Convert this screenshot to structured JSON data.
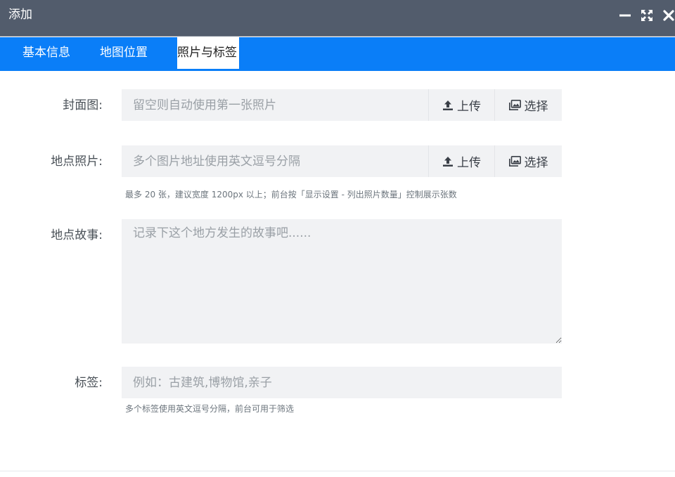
{
  "window": {
    "title": "添加",
    "controls": [
      "minimize-icon",
      "maximize-icon",
      "close-icon"
    ]
  },
  "tabs": [
    {
      "label": "基本信息",
      "active": false
    },
    {
      "label": "地图位置",
      "active": false
    },
    {
      "label": "照片与标签",
      "active": true
    }
  ],
  "form": {
    "cover": {
      "label": "封面图:",
      "placeholder": "留空则自动使用第一张照片",
      "upload_label": "上传",
      "select_label": "选择"
    },
    "photos": {
      "label": "地点照片:",
      "placeholder": "多个图片地址使用英文逗号分隔",
      "upload_label": "上传",
      "select_label": "选择",
      "hint": "最多 20 张，建议宽度 1200px 以上；前台按「显示设置 - 列出照片数量」控制展示张数"
    },
    "story": {
      "label": "地点故事:",
      "placeholder": "记录下这个地方发生的故事吧......"
    },
    "tags": {
      "label": "标签:",
      "placeholder": "例如：古建筑,博物馆,亲子",
      "hint": "多个标签使用英文逗号分隔，前台可用于筛选"
    }
  },
  "colors": {
    "titlebar": "#525c6c",
    "tabbar": "#0a7ef8",
    "input_bg": "#f1f2f4"
  }
}
